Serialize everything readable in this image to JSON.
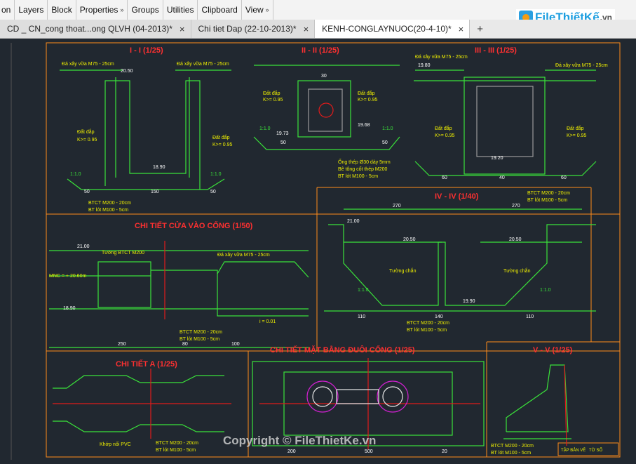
{
  "ribbon": {
    "items": [
      {
        "label": "on",
        "chevron": false
      },
      {
        "label": "Layers",
        "chevron": false
      },
      {
        "label": "Block",
        "chevron": false
      },
      {
        "label": "Properties",
        "chevron": true
      },
      {
        "label": "Groups",
        "chevron": false
      },
      {
        "label": "Utilities",
        "chevron": false
      },
      {
        "label": "Clipboard",
        "chevron": false
      },
      {
        "label": "View",
        "chevron": true
      }
    ]
  },
  "brand": {
    "name": "FileThiếtKế",
    "suffix": ".vn"
  },
  "tabs": [
    {
      "label": "CD _ CN_cong thoat...ong QLVH (04-2013)*",
      "close": "×"
    },
    {
      "label": "Chi tiet Dap (22-10-2013)*",
      "close": "×"
    },
    {
      "label": "KENH-CONGLAYNUOC(20-4-10)*",
      "close": "×",
      "active": true
    }
  ],
  "tab_add": "+",
  "drawing": {
    "section_titles": {
      "s1": "I - I (1/25)",
      "s2": "II - II (1/25)",
      "s3": "III - III (1/25)",
      "s4": "IV - IV (1/40)",
      "s5": "CHI TIẾT CỬA VÀO CỐNG (1/50)",
      "s6": "CHI TIẾT A (1/25)",
      "s7": "CHI TIẾT MẶT BẰNG ĐUÔI CỐNG (1/25)",
      "s8": "V - V (1/25)"
    },
    "notes": {
      "da_xay": "Đá xây vữa M75 - 25cm",
      "dat_dap": "Đất đắp",
      "k": "K>= 0.95",
      "btct": "BTCT M200 - 20cm",
      "bt_lot": "BT lót M100 - 5cm",
      "ong_thep": "Ống thép Ø30 dày 5mm",
      "be_tong": "Bê tông cốt thép M200",
      "tuong_chan": "Tường chắn",
      "tuong_btct": "Tường BTCT M200",
      "mnc": "MNC = + 20.60m",
      "slope": "i = 0.01",
      "khop_noi": "Khớp nối PVC",
      "slope_ratio": "1:1.0"
    },
    "elevations": {
      "e1": "20.50",
      "e2": "18.90",
      "e3": "19.73",
      "e4": "19.68",
      "e5": "19.20",
      "e6": "21.00",
      "e7": "20.50",
      "e8": "19.90",
      "e9": "18.90",
      "e10": "21.00",
      "e11": "19.80",
      "e12": "20.50"
    },
    "dims": {
      "d50": "50",
      "d40": "40",
      "d150": "150",
      "d110": "110",
      "d140": "140",
      "d270": "270",
      "d500": "500",
      "d20": "20",
      "d30": "30",
      "d60": "60",
      "d80": "80",
      "d100": "100",
      "d200": "200",
      "d250": "250",
      "d60_b": "60",
      "d50_b": "50"
    },
    "sheet": {
      "label": "TẬP BẢN VẼ",
      "num": "TỜ SỐ"
    },
    "watermark": "Copyright © FileThietKe.vn"
  }
}
